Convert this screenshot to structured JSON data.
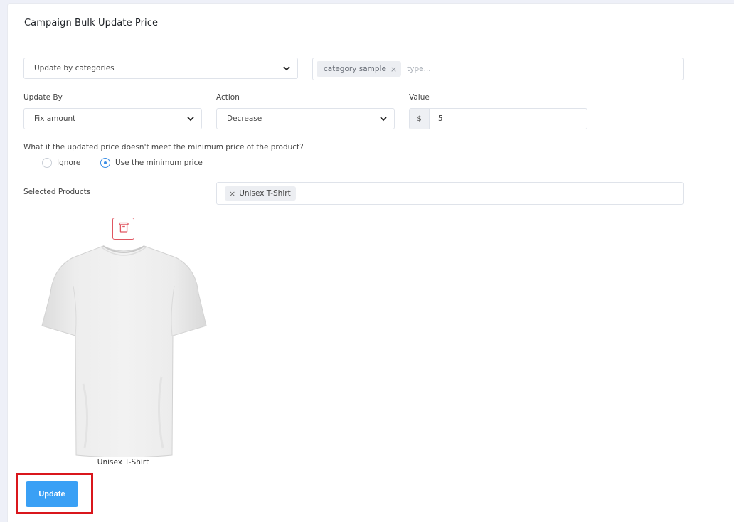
{
  "header": {
    "title": "Campaign Bulk Update Price"
  },
  "update_mode": {
    "selected": "Update by categories"
  },
  "categories": {
    "chips": [
      {
        "label": "category sample",
        "remove": "×"
      }
    ],
    "placeholder": "type..."
  },
  "update_by": {
    "label": "Update By",
    "selected": "Fix amount"
  },
  "action": {
    "label": "Action",
    "selected": "Decrease"
  },
  "value": {
    "label": "Value",
    "prefix": "$",
    "amount": "5"
  },
  "minimum_price": {
    "question": "What if the updated price doesn't meet the minimum price of the product?",
    "options": [
      {
        "label": "Ignore",
        "checked": false
      },
      {
        "label": "Use the minimum price",
        "checked": true
      }
    ]
  },
  "selected_products": {
    "label": "Selected Products",
    "chips": [
      {
        "label": "Unisex T-Shirt",
        "remove": "×"
      }
    ]
  },
  "product_card": {
    "name": "Unisex T-Shirt",
    "delete_icon": "trash-icon",
    "image_icon": "tshirt-image"
  },
  "footer": {
    "update_label": "Update"
  },
  "colors": {
    "primary": "#3aa0f5",
    "danger": "#e05661",
    "highlight": "#d9161c",
    "radio_accent": "#3a8ee6"
  }
}
